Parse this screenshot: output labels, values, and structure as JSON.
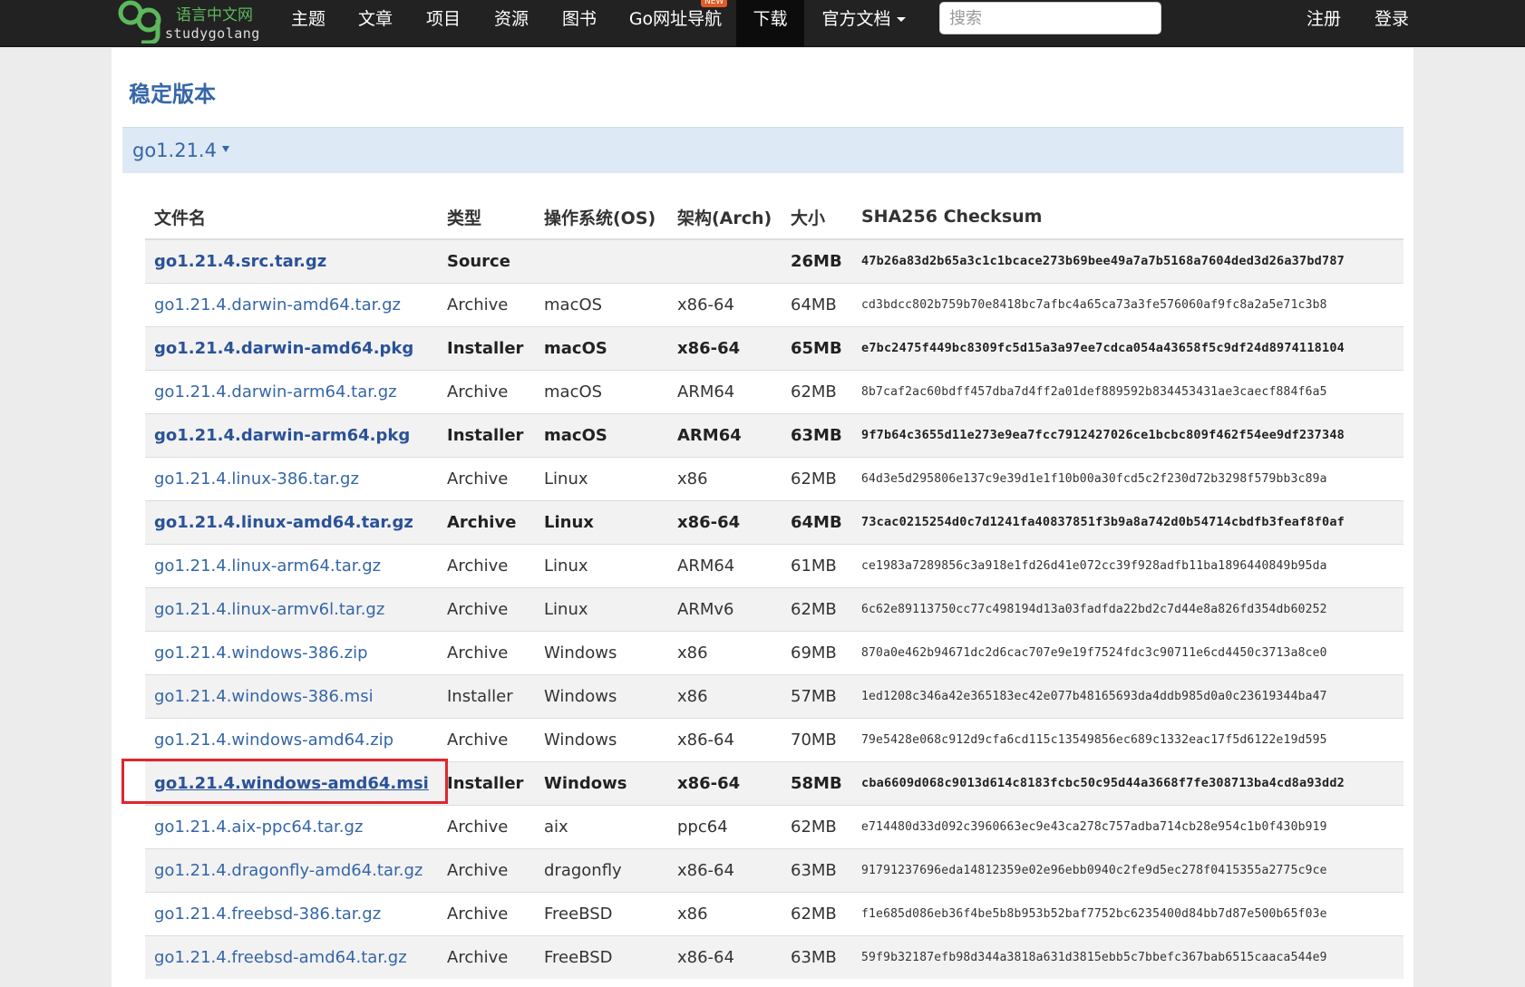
{
  "nav": {
    "logo_cn": "语言中文网",
    "logo_en": "studygolang",
    "items": [
      {
        "label": "主题"
      },
      {
        "label": "文章"
      },
      {
        "label": "项目"
      },
      {
        "label": "资源"
      },
      {
        "label": "图书"
      },
      {
        "label": "Go网址导航",
        "badge": "NEW"
      },
      {
        "label": "下载",
        "active": true
      },
      {
        "label": "官方文档"
      }
    ],
    "search_placeholder": "搜索",
    "register": "注册",
    "login": "登录"
  },
  "page": {
    "section_title": "稳定版本",
    "version": "go1.21.4"
  },
  "table": {
    "headers": [
      "文件名",
      "类型",
      "操作系统(OS)",
      "架构(Arch)",
      "大小",
      "SHA256 Checksum"
    ],
    "rows": [
      {
        "file": "go1.21.4.src.tar.gz",
        "kind": "Source",
        "os": "",
        "arch": "",
        "size": "26MB",
        "checksum": "47b26a83d2b65a3c1c1bcace273b69bee49a7a7b5168a7604ded3d26a37bd787",
        "featured": true
      },
      {
        "file": "go1.21.4.darwin-amd64.tar.gz",
        "kind": "Archive",
        "os": "macOS",
        "arch": "x86-64",
        "size": "64MB",
        "checksum": "cd3bdcc802b759b70e8418bc7afbc4a65ca73a3fe576060af9fc8a2a5e71c3b8"
      },
      {
        "file": "go1.21.4.darwin-amd64.pkg",
        "kind": "Installer",
        "os": "macOS",
        "arch": "x86-64",
        "size": "65MB",
        "checksum": "e7bc2475f449bc8309fc5d15a3a97ee7cdca054a43658f5c9df24d8974118104",
        "featured": true
      },
      {
        "file": "go1.21.4.darwin-arm64.tar.gz",
        "kind": "Archive",
        "os": "macOS",
        "arch": "ARM64",
        "size": "62MB",
        "checksum": "8b7caf2ac60bdff457dba7d4ff2a01def889592b834453431ae3caecf884f6a5"
      },
      {
        "file": "go1.21.4.darwin-arm64.pkg",
        "kind": "Installer",
        "os": "macOS",
        "arch": "ARM64",
        "size": "63MB",
        "checksum": "9f7b64c3655d11e273e9ea7fcc7912427026ce1bcbc809f462f54ee9df237348",
        "featured": true
      },
      {
        "file": "go1.21.4.linux-386.tar.gz",
        "kind": "Archive",
        "os": "Linux",
        "arch": "x86",
        "size": "62MB",
        "checksum": "64d3e5d295806e137c9e39d1e1f10b00a30fcd5c2f230d72b3298f579bb3c89a"
      },
      {
        "file": "go1.21.4.linux-amd64.tar.gz",
        "kind": "Archive",
        "os": "Linux",
        "arch": "x86-64",
        "size": "64MB",
        "checksum": "73cac0215254d0c7d1241fa40837851f3b9a8a742d0b54714cbdfb3feaf8f0af",
        "featured": true
      },
      {
        "file": "go1.21.4.linux-arm64.tar.gz",
        "kind": "Archive",
        "os": "Linux",
        "arch": "ARM64",
        "size": "61MB",
        "checksum": "ce1983a7289856c3a918e1fd26d41e072cc39f928adfb11ba1896440849b95da"
      },
      {
        "file": "go1.21.4.linux-armv6l.tar.gz",
        "kind": "Archive",
        "os": "Linux",
        "arch": "ARMv6",
        "size": "62MB",
        "checksum": "6c62e89113750cc77c498194d13a03fadfda22bd2c7d44e8a826fd354db60252"
      },
      {
        "file": "go1.21.4.windows-386.zip",
        "kind": "Archive",
        "os": "Windows",
        "arch": "x86",
        "size": "69MB",
        "checksum": "870a0e462b94671dc2d6cac707e9e19f7524fdc3c90711e6cd4450c3713a8ce0"
      },
      {
        "file": "go1.21.4.windows-386.msi",
        "kind": "Installer",
        "os": "Windows",
        "arch": "x86",
        "size": "57MB",
        "checksum": "1ed1208c346a42e365183ec42e077b48165693da4ddb985d0a0c23619344ba47"
      },
      {
        "file": "go1.21.4.windows-amd64.zip",
        "kind": "Archive",
        "os": "Windows",
        "arch": "x86-64",
        "size": "70MB",
        "checksum": "79e5428e068c912d9cfa6cd115c13549856ec689c1332eac17f5d6122e19d595"
      },
      {
        "file": "go1.21.4.windows-amd64.msi",
        "kind": "Installer",
        "os": "Windows",
        "arch": "x86-64",
        "size": "58MB",
        "checksum": "cba6609d068c9013d614c8183fcbc50c95d44a3668f7fe308713ba4cd8a93dd2",
        "featured": true,
        "highlighted": true
      },
      {
        "file": "go1.21.4.aix-ppc64.tar.gz",
        "kind": "Archive",
        "os": "aix",
        "arch": "ppc64",
        "size": "62MB",
        "checksum": "e714480d33d092c3960663ec9e43ca278c757adba714cb28e954c1b0f430b919"
      },
      {
        "file": "go1.21.4.dragonfly-amd64.tar.gz",
        "kind": "Archive",
        "os": "dragonfly",
        "arch": "x86-64",
        "size": "63MB",
        "checksum": "91791237696eda14812359e02e96ebb0940c2fe9d5ec278f0415355a2775c9ce"
      },
      {
        "file": "go1.21.4.freebsd-386.tar.gz",
        "kind": "Archive",
        "os": "FreeBSD",
        "arch": "x86",
        "size": "62MB",
        "checksum": "f1e685d086eb36f4be5b8b953b52baf7752bc6235400d84bb7d87e500b65f03e"
      },
      {
        "file": "go1.21.4.freebsd-amd64.tar.gz",
        "kind": "Archive",
        "os": "FreeBSD",
        "arch": "x86-64",
        "size": "63MB",
        "checksum": "59f9b32187efb98d344a3818a631d3815ebb5c7bbefc367bab6515caaca544e9"
      }
    ]
  },
  "colors": {
    "nav_bg": "#222222",
    "link": "#3566a8",
    "version_bar": "#dde9f5",
    "highlight_box": "#e0262e",
    "logo_green": "#5cb85c"
  }
}
